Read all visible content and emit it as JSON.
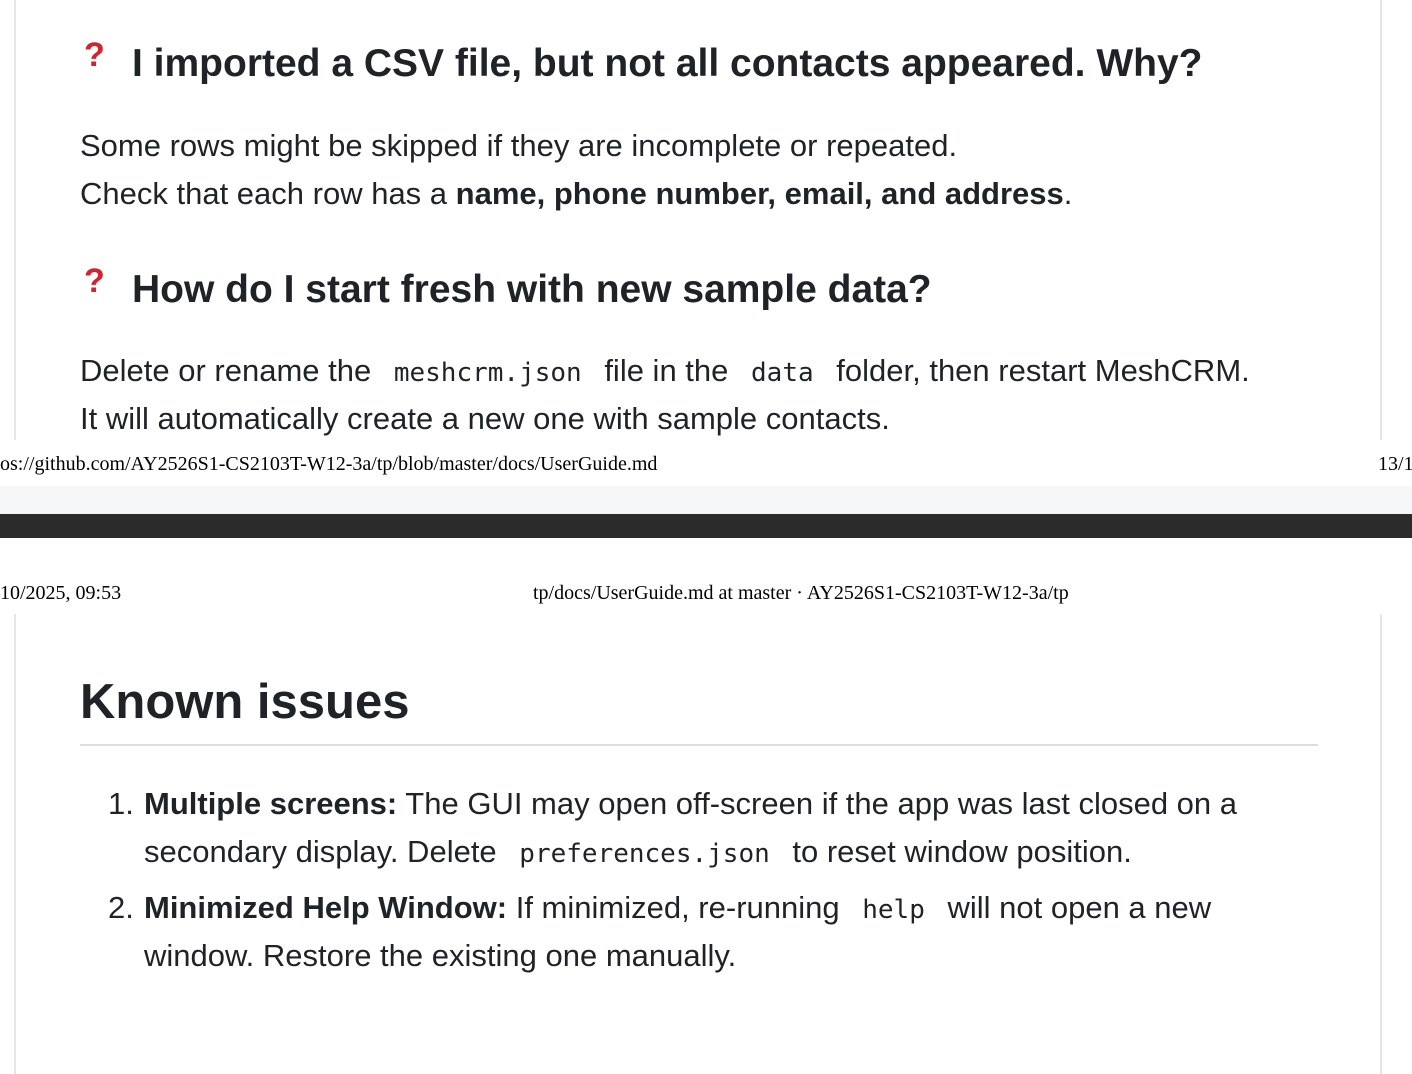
{
  "faq": [
    {
      "question": "I imported a CSV file, but not all contacts appeared. Why?",
      "answer_line1": "Some rows might be skipped if they are incomplete or repeated.",
      "answer_line2_prefix": "Check that each row has a ",
      "answer_line2_bold": "name, phone number, email, and address",
      "answer_line2_suffix": "."
    },
    {
      "question": "How do I start fresh with new sample data?",
      "answer_part1": "Delete or rename the",
      "answer_code1": "meshcrm.json",
      "answer_part2": "file in the",
      "answer_code2": "data",
      "answer_part3": "folder, then restart MeshCRM.",
      "answer_line2": "It will automatically create a new one with sample contacts."
    }
  ],
  "faq_mark": "?",
  "print_footer": {
    "url": "os://github.com/AY2526S1-CS2103T-W12-3a/tp/blob/master/docs/UserGuide.md",
    "page": "13/1"
  },
  "print_header": {
    "datetime": "10/2025, 09:53",
    "title": "tp/docs/UserGuide.md at master · AY2526S1-CS2103T-W12-3a/tp"
  },
  "known_issues": {
    "heading": "Known issues",
    "items": [
      {
        "number": "1.",
        "title": "Multiple screens:",
        "text_part1": " The GUI may open off-screen if the app was last closed on a",
        "text_line2_prefix": "secondary display. Delete",
        "code": "preferences.json",
        "text_line2_suffix": "to reset window position."
      },
      {
        "number": "2.",
        "title": "Minimized Help Window:",
        "text_part1": " If minimized, re-running",
        "code": "help",
        "text_part2": "will not open a new",
        "text_line2": "window. Restore the existing one manually."
      }
    ]
  }
}
